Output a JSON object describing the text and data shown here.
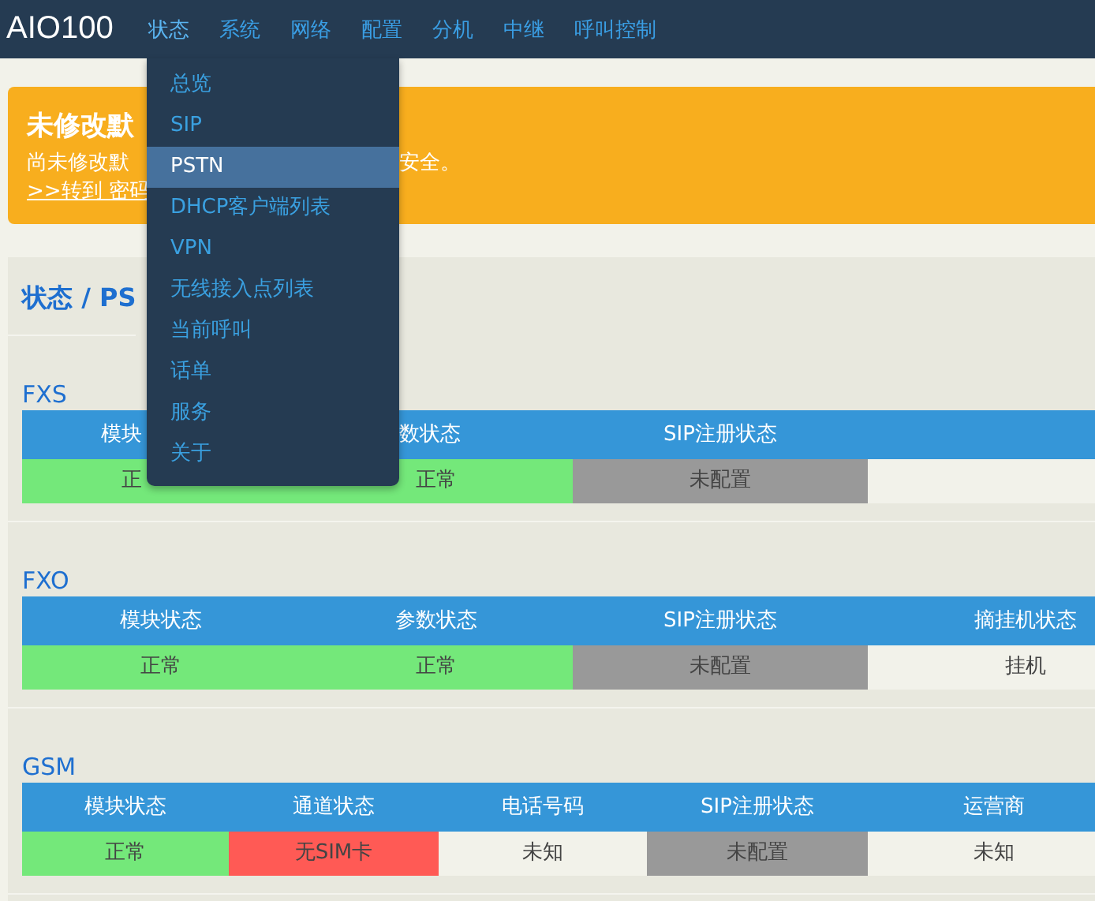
{
  "nav": {
    "brand": "AIO100",
    "items": [
      {
        "label": "状态",
        "selected": true
      },
      {
        "label": "系统",
        "selected": false
      },
      {
        "label": "网络",
        "selected": false
      },
      {
        "label": "配置",
        "selected": false
      },
      {
        "label": "分机",
        "selected": false
      },
      {
        "label": "中继",
        "selected": false
      },
      {
        "label": "呼叫控制",
        "selected": false
      }
    ]
  },
  "dropdown": [
    {
      "label": "总览",
      "selected": false
    },
    {
      "label": "SIP",
      "selected": false
    },
    {
      "label": "PSTN",
      "selected": true
    },
    {
      "label": "DHCP客户端列表",
      "selected": false
    },
    {
      "label": "VPN",
      "selected": false
    },
    {
      "label": "无线接入点列表",
      "selected": false
    },
    {
      "label": "当前呼叫",
      "selected": false
    },
    {
      "label": "话单",
      "selected": false
    },
    {
      "label": "服务",
      "selected": false
    },
    {
      "label": "关于",
      "selected": false
    }
  ],
  "warning": {
    "title": "未修改默",
    "text": "尚未修改默",
    "text_right": "安全。",
    "link": ">>转到 密码"
  },
  "panel": {
    "title": "状态 / PS",
    "sections": [
      {
        "title": "FXS",
        "columns": [
          {
            "label": "模块",
            "kind": "cutright"
          },
          {
            "label": "数状态",
            "kind": "cutleft"
          },
          {
            "label": "SIP注册状态"
          }
        ],
        "cells": [
          {
            "text": "正",
            "color": "#74e87a",
            "kind": "cutright"
          },
          {
            "text": "正常",
            "color": "#74e87a"
          },
          {
            "text": "未配置",
            "color": "#999999"
          },
          {
            "color": "#f2f2ea"
          }
        ]
      },
      {
        "title": "FXO",
        "columns": [
          {
            "label": "模块状态"
          },
          {
            "label": "参数状态"
          },
          {
            "label": "SIP注册状态"
          },
          {
            "label": "摘挂机状态"
          }
        ],
        "cells": [
          {
            "text": "正常",
            "color": "#74e87a"
          },
          {
            "text": "正常",
            "color": "#74e87a"
          },
          {
            "text": "未配置",
            "color": "#999999"
          },
          {
            "text": "挂机",
            "color": "#f2f2ea"
          }
        ]
      },
      {
        "title": "GSM",
        "columns": [
          {
            "label": "模块状态"
          },
          {
            "label": "通道状态"
          },
          {
            "label": "电话号码"
          },
          {
            "label": "SIP注册状态"
          },
          {
            "label": "运营商"
          }
        ],
        "cells": [
          {
            "text": "正常",
            "color": "#74e87a"
          },
          {
            "text": "无SIM卡",
            "color": "#ff5a55"
          },
          {
            "text": "未知",
            "color": "#f2f2ea"
          },
          {
            "text": "未配置",
            "color": "#999999"
          },
          {
            "text": "未知",
            "color": "#f2f2ea"
          }
        ]
      }
    ]
  }
}
